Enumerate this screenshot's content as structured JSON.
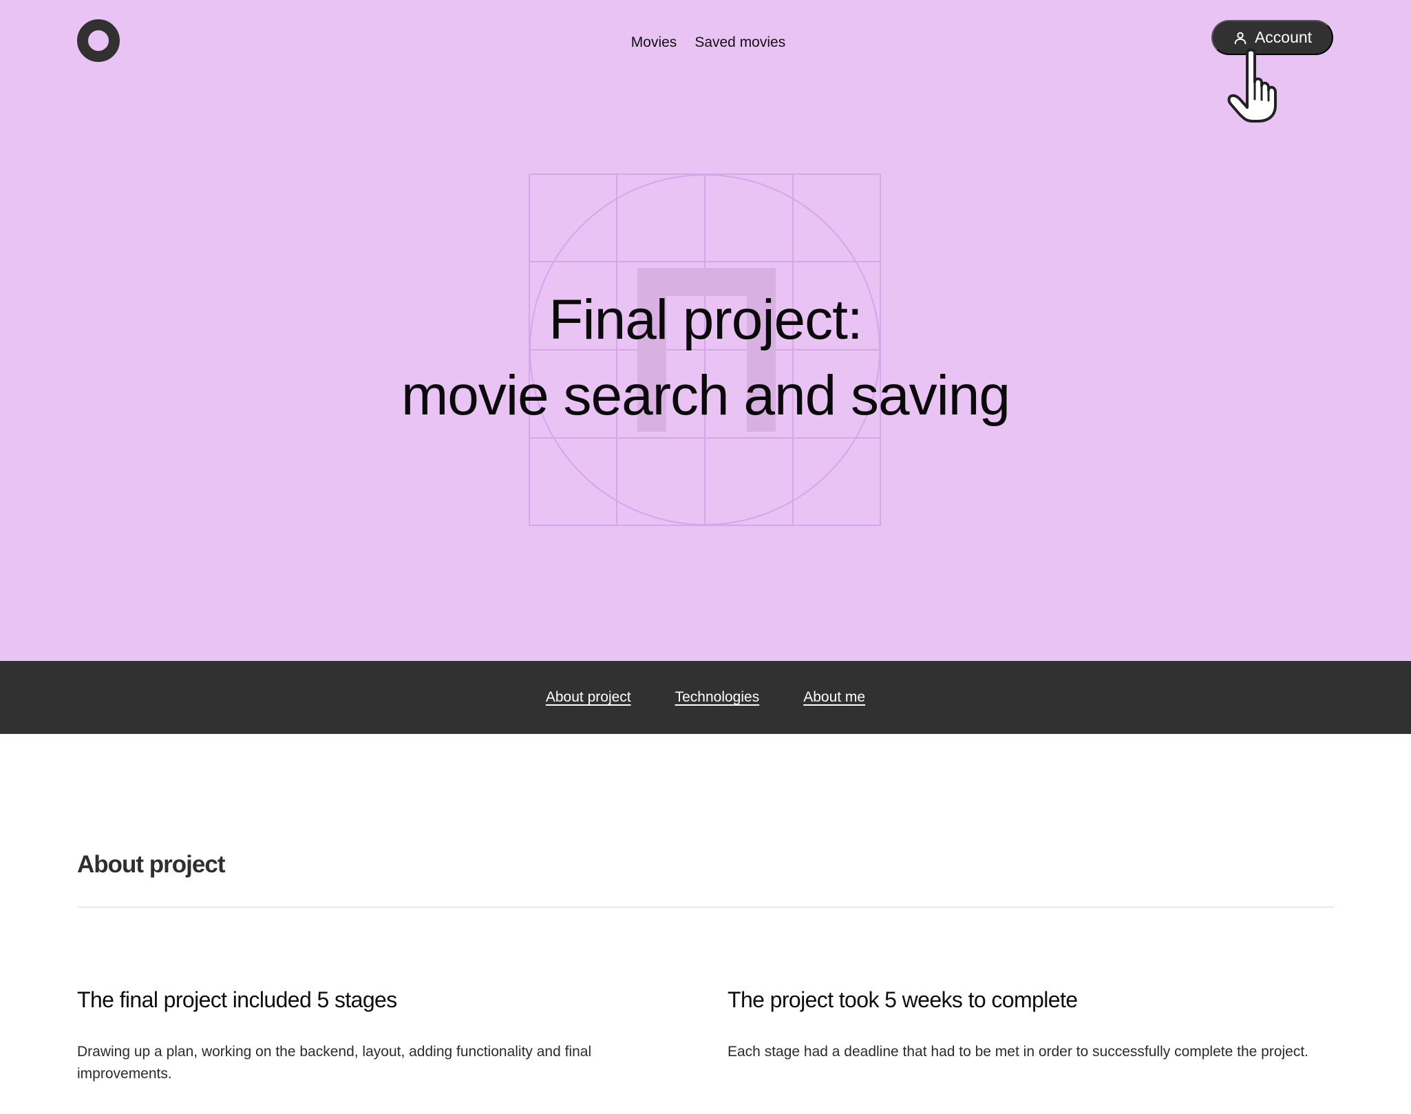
{
  "header": {
    "logo_icon": "ring-logo-icon",
    "nav": [
      {
        "label": "Movies"
      },
      {
        "label": "Saved movies"
      }
    ],
    "account_button": {
      "label": "Account",
      "icon": "user-icon"
    }
  },
  "hero": {
    "title_line1": "Final project:",
    "title_line2": "movie search and saving",
    "background_color": "#e9c3f4"
  },
  "section_nav": {
    "links": [
      {
        "label": "About project"
      },
      {
        "label": "Technologies"
      },
      {
        "label": "About me"
      }
    ],
    "background_color": "#313131"
  },
  "about": {
    "title": "About project",
    "columns": [
      {
        "heading": "The final project included 5 stages",
        "text": "Drawing up a plan, working on the backend, layout, adding functionality and final improvements."
      },
      {
        "heading": "The project took 5 weeks to complete",
        "text": "Each stage had a deadline that had to be met in order to successfully complete the project."
      }
    ]
  },
  "colors": {
    "dark": "#313131",
    "hero_bg": "#e9c3f4"
  }
}
